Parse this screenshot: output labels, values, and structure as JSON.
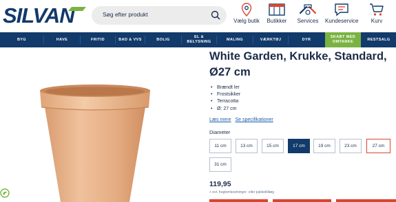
{
  "header": {
    "logo_text": "SILVAN",
    "search_placeholder": "Søg efter produkt",
    "actions": [
      {
        "label": "Vælg butik",
        "icon": "location-pin-icon"
      },
      {
        "label": "Butikker",
        "icon": "store-icon"
      },
      {
        "label": "Services",
        "icon": "tools-icon"
      },
      {
        "label": "Kundeservice",
        "icon": "chat-icon"
      },
      {
        "label": "Kurv",
        "icon": "cart-icon"
      }
    ]
  },
  "nav": {
    "items": [
      "BYG",
      "HAVE",
      "FRITID",
      "BAD & VVS",
      "BOLIG",
      "EL & BELYSNING",
      "MALING",
      "VÆRKTØJ",
      "DYR",
      "SKABT MED OMTANKE",
      "RESTSALG"
    ]
  },
  "product": {
    "title": "White Garden, Krukke, Standard, Ø27 cm",
    "bullets": [
      "Brændt ler",
      "Frostsikker",
      "Terracotta",
      "Ø: 27 cm"
    ],
    "link_more": "Læs mere",
    "link_specs": "Se specifikationer",
    "diameter_label": "Diameter",
    "sizes": [
      "11 cm",
      "13 cm",
      "15 cm",
      "17 cm",
      "19 cm",
      "23 cm",
      "27 cm",
      "31 cm"
    ],
    "selected_size": "17 cm",
    "outlined_size": "27 cm",
    "price": "119,95",
    "freight_note": "+ evt. fragtomkostninger- eller pakkeltillæg"
  },
  "colors": {
    "navy": "#123a6b",
    "green": "#7ab342",
    "accent_red": "#d9452f",
    "pot": "#e8b48a"
  }
}
